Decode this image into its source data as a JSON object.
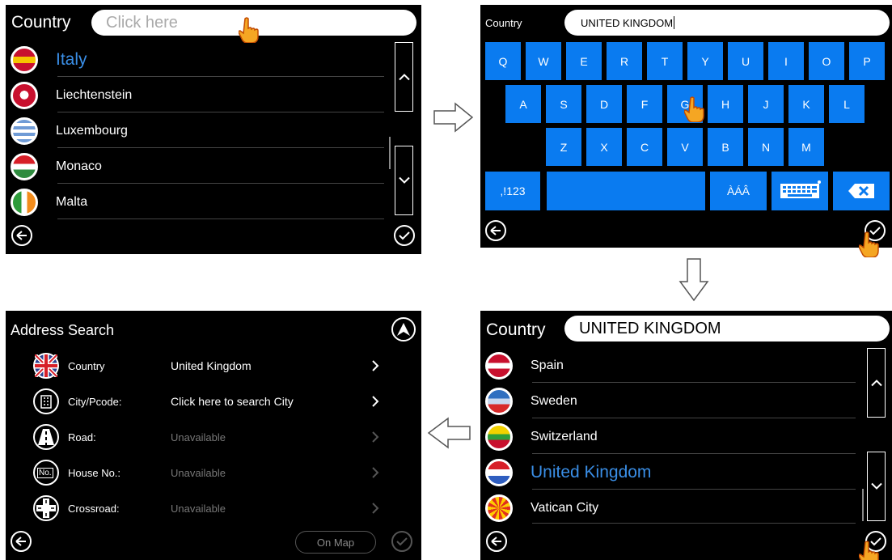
{
  "panel1": {
    "title": "Country",
    "search_placeholder": "Click here",
    "items": [
      {
        "label": "Italy",
        "selected": true
      },
      {
        "label": "Liechtenstein",
        "selected": false
      },
      {
        "label": "Luxembourg",
        "selected": false
      },
      {
        "label": "Monaco",
        "selected": false
      },
      {
        "label": "Malta",
        "selected": false
      }
    ]
  },
  "panel2": {
    "title": "Country",
    "search_value": "UNITED KINGDOM",
    "keys_row1": [
      "Q",
      "W",
      "E",
      "R",
      "T",
      "Y",
      "U",
      "I",
      "O",
      "P"
    ],
    "keys_row2": [
      "A",
      "S",
      "D",
      "F",
      "G",
      "H",
      "J",
      "K",
      "L"
    ],
    "keys_row3": [
      "Z",
      "X",
      "C",
      "V",
      "B",
      "N",
      "M"
    ],
    "key_symbols": ",!123",
    "key_accents": "ÀÁÂ"
  },
  "panel3": {
    "title": "Country",
    "search_value": "UNITED KINGDOM",
    "items": [
      {
        "label": "Spain",
        "selected": false
      },
      {
        "label": "Sweden",
        "selected": false
      },
      {
        "label": "Switzerland",
        "selected": false
      },
      {
        "label": "United Kingdom",
        "selected": true
      },
      {
        "label": "Vatican City",
        "selected": false
      }
    ]
  },
  "panel4": {
    "title": "Address Search",
    "rows": [
      {
        "label": "Country",
        "value": "United Kingdom",
        "enabled": true
      },
      {
        "label": "City/Pcode:",
        "value": "Click here to search City",
        "enabled": true
      },
      {
        "label": "Road:",
        "value": "Unavailable",
        "enabled": false
      },
      {
        "label": "House No.:",
        "value": "Unavailable",
        "enabled": false
      },
      {
        "label": "Crossroad:",
        "value": "Unavailable",
        "enabled": false
      }
    ],
    "house_icon_text": "No.",
    "on_map_label": "On Map"
  },
  "colors": {
    "accent": "#0a7bf0",
    "selected_text": "#3a8ee6",
    "background": "#000000"
  }
}
